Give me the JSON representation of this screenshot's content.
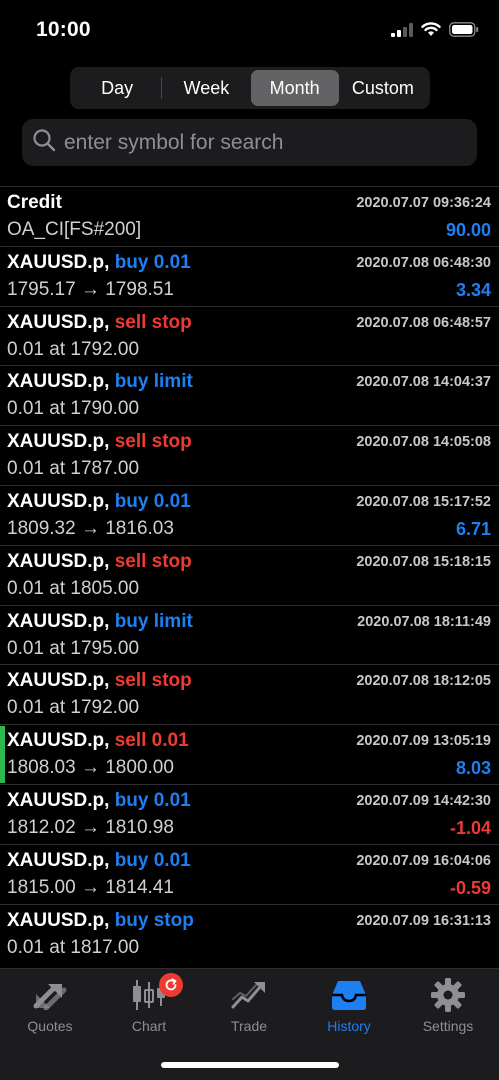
{
  "status": {
    "time": "10:00"
  },
  "period_tabs": [
    {
      "label": "Day",
      "active": false
    },
    {
      "label": "Week",
      "active": false
    },
    {
      "label": "Month",
      "active": true
    },
    {
      "label": "Custom",
      "active": false
    }
  ],
  "search": {
    "placeholder": "enter symbol for search"
  },
  "colors": {
    "blue": "#1e7ff0",
    "red": "#ee3b30",
    "green_marker": "#2fb84f"
  },
  "history": [
    {
      "symbol": "Credit",
      "action": "",
      "action_color": "blue",
      "date": "2020.07.07 09:36:24",
      "detail": "OA_CI[FS#200]",
      "amount": "90.00",
      "amount_color": "blue",
      "marked": false
    },
    {
      "symbol": "XAUUSD.p,",
      "action": "buy 0.01",
      "action_color": "blue",
      "date": "2020.07.08 06:48:30",
      "detail": "1795.17 → 1798.51",
      "amount": "3.34",
      "amount_color": "blue",
      "marked": false
    },
    {
      "symbol": "XAUUSD.p,",
      "action": "sell stop",
      "action_color": "red",
      "date": "2020.07.08 06:48:57",
      "detail": "0.01 at 1792.00",
      "amount": "",
      "amount_color": "blue",
      "marked": false
    },
    {
      "symbol": "XAUUSD.p,",
      "action": "buy limit",
      "action_color": "blue",
      "date": "2020.07.08 14:04:37",
      "detail": "0.01 at 1790.00",
      "amount": "",
      "amount_color": "blue",
      "marked": false
    },
    {
      "symbol": "XAUUSD.p,",
      "action": "sell stop",
      "action_color": "red",
      "date": "2020.07.08 14:05:08",
      "detail": "0.01 at 1787.00",
      "amount": "",
      "amount_color": "blue",
      "marked": false
    },
    {
      "symbol": "XAUUSD.p,",
      "action": "buy 0.01",
      "action_color": "blue",
      "date": "2020.07.08 15:17:52",
      "detail": "1809.32 → 1816.03",
      "amount": "6.71",
      "amount_color": "blue",
      "marked": false
    },
    {
      "symbol": "XAUUSD.p,",
      "action": "sell stop",
      "action_color": "red",
      "date": "2020.07.08 15:18:15",
      "detail": "0.01 at 1805.00",
      "amount": "",
      "amount_color": "blue",
      "marked": false
    },
    {
      "symbol": "XAUUSD.p,",
      "action": "buy limit",
      "action_color": "blue",
      "date": "2020.07.08 18:11:49",
      "detail": "0.01 at 1795.00",
      "amount": "",
      "amount_color": "blue",
      "marked": false
    },
    {
      "symbol": "XAUUSD.p,",
      "action": "sell stop",
      "action_color": "red",
      "date": "2020.07.08 18:12:05",
      "detail": "0.01 at 1792.00",
      "amount": "",
      "amount_color": "blue",
      "marked": false
    },
    {
      "symbol": "XAUUSD.p,",
      "action": "sell 0.01",
      "action_color": "red",
      "date": "2020.07.09 13:05:19",
      "detail": "1808.03 → 1800.00",
      "amount": "8.03",
      "amount_color": "blue",
      "marked": true
    },
    {
      "symbol": "XAUUSD.p,",
      "action": "buy 0.01",
      "action_color": "blue",
      "date": "2020.07.09 14:42:30",
      "detail": "1812.02 → 1810.98",
      "amount": "-1.04",
      "amount_color": "red",
      "marked": false
    },
    {
      "symbol": "XAUUSD.p,",
      "action": "buy 0.01",
      "action_color": "blue",
      "date": "2020.07.09 16:04:06",
      "detail": "1815.00 → 1814.41",
      "amount": "-0.59",
      "amount_color": "red",
      "marked": false
    },
    {
      "symbol": "XAUUSD.p,",
      "action": "buy stop",
      "action_color": "blue",
      "date": "2020.07.09 16:31:13",
      "detail": "0.01 at 1817.00",
      "amount": "",
      "amount_color": "blue",
      "marked": false
    }
  ],
  "tabbar": [
    {
      "label": "Quotes",
      "icon": "quotes-arrows-icon",
      "active": false
    },
    {
      "label": "Chart",
      "icon": "candlestick-chart-icon",
      "active": false,
      "badge": "refresh-icon"
    },
    {
      "label": "Trade",
      "icon": "trade-trend-icon",
      "active": false
    },
    {
      "label": "History",
      "icon": "inbox-tray-icon",
      "active": true
    },
    {
      "label": "Settings",
      "icon": "gear-icon",
      "active": false
    }
  ]
}
